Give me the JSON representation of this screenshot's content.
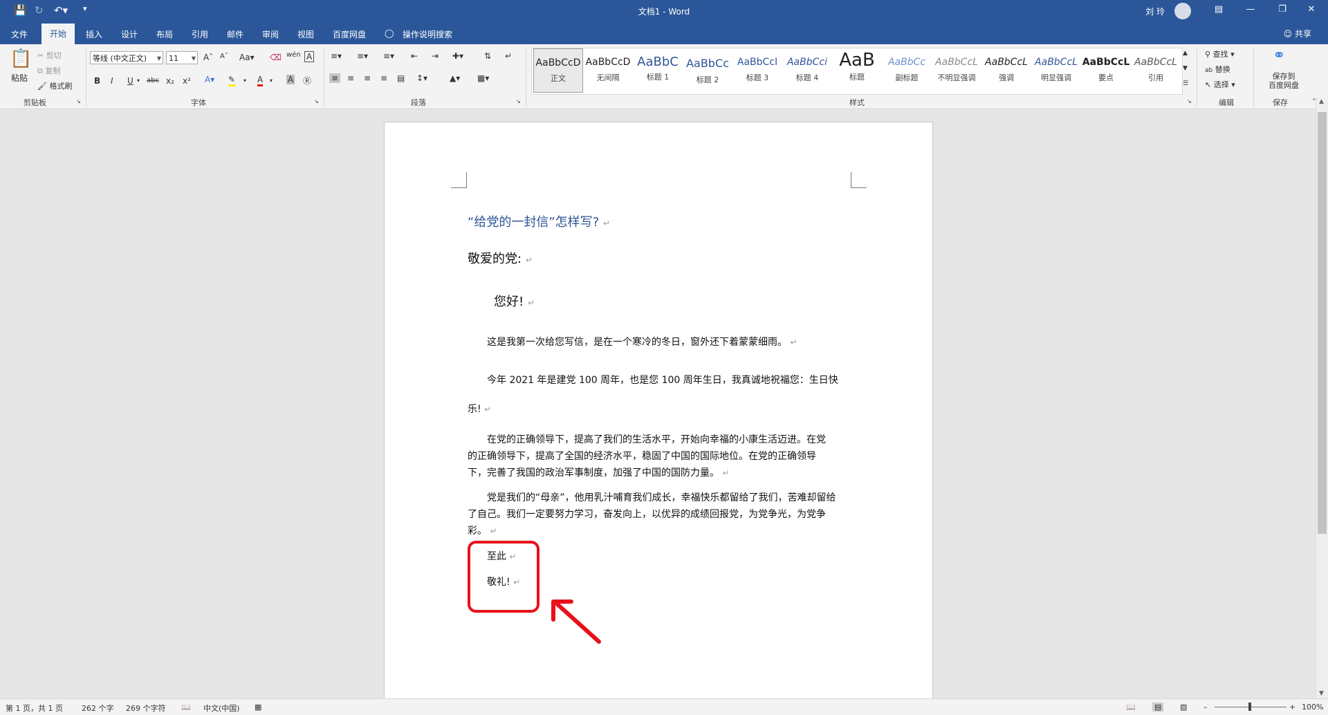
{
  "titlebar": {
    "doc_title": "文档1  -  Word",
    "user_name": "刘 玲",
    "save_icon": "save-icon",
    "undo_icon": "undo-icon",
    "redo_icon": "redo-icon",
    "customize_icon": "customize-quick-access-icon"
  },
  "tabs": [
    {
      "label": "文件"
    },
    {
      "label": "开始"
    },
    {
      "label": "插入"
    },
    {
      "label": "设计"
    },
    {
      "label": "布局"
    },
    {
      "label": "引用"
    },
    {
      "label": "邮件"
    },
    {
      "label": "审阅"
    },
    {
      "label": "视图"
    },
    {
      "label": "百度网盘"
    },
    {
      "label": "操作说明搜索"
    }
  ],
  "active_tab": "开始",
  "share_label": "共享",
  "ribbon": {
    "clipboard": {
      "paste": "粘贴",
      "cut": "剪切",
      "copy": "复制",
      "format_painter": "格式刷",
      "label": "剪贴板"
    },
    "font": {
      "font_name": "等线 (中文正文)",
      "font_size": "11",
      "label": "字体"
    },
    "paragraph": {
      "label": "段落"
    },
    "styles": {
      "label": "样式",
      "items": [
        {
          "preview": "AaBbCcD",
          "name": "正文"
        },
        {
          "preview": "AaBbCcD",
          "name": "无间隔"
        },
        {
          "preview": "AaBbC",
          "name": "标题 1"
        },
        {
          "preview": "AaBbCc",
          "name": "标题 2"
        },
        {
          "preview": "AaBbCcI",
          "name": "标题 3"
        },
        {
          "preview": "AaBbCci",
          "name": "标题 4"
        },
        {
          "preview": "AaB",
          "name": "标题"
        },
        {
          "preview": "AaBbCc",
          "name": "副标题"
        },
        {
          "preview": "AaBbCcL",
          "name": "不明显强调"
        },
        {
          "preview": "AaBbCcL",
          "name": "强调"
        },
        {
          "preview": "AaBbCcL",
          "name": "明显强调"
        },
        {
          "preview": "AaBbCcL",
          "name": "要点"
        },
        {
          "preview": "AaBbCcL",
          "name": "引用"
        }
      ]
    },
    "editing": {
      "find": "查找",
      "replace": "替换",
      "select": "选择",
      "label": "编辑"
    },
    "save": {
      "line1": "保存到",
      "line2": "百度网盘",
      "label": "保存"
    }
  },
  "document": {
    "title": "“给党的一封信”怎样写?",
    "salutation": "敬爱的党:",
    "greeting": "您好!",
    "p1": "这是我第一次给您写信，是在一个寒冷的冬日，窗外还下着蒙蒙细雨。",
    "p2a": "今年 2021 年是建党 100 周年，也是您 100 周年生日，我真诚地祝福您：生日快",
    "p2b": "乐!",
    "p3a": "在党的正确领导下，提高了我们的生活水平，开始向幸福的小康生活迈进。在党",
    "p3b": "的正确领导下，提高了全国的经济水平，稳固了中国的国际地位。在党的正确领导",
    "p3c": "下，完善了我国的政治军事制度，加强了中国的国防力量。",
    "p4a": "党是我们的“母亲”，他用乳汁哺育我们成长，幸福快乐都留给了我们，苦难却留给",
    "p4b": "了自己。我们一定要努力学习，奋发向上，以优异的成绩回报党，为党争光，为党争",
    "p4c": "彩。",
    "closing1": "至此",
    "closing2": "敬礼!",
    "para_mark": "↵"
  },
  "statusbar": {
    "page": "第 1 页，共 1 页",
    "words": "262 个字",
    "chars": "269 个字符",
    "language": "中文(中国)",
    "zoom": "100%"
  },
  "annotation": {
    "color": "#e8101a"
  },
  "watermark": {
    "brand": "Bai",
    "brand2": "du",
    "cn": "经验",
    "url": "jingyan.baidu.com"
  },
  "colors": {
    "accent": "#2b579a",
    "heading": "#2f5496"
  }
}
